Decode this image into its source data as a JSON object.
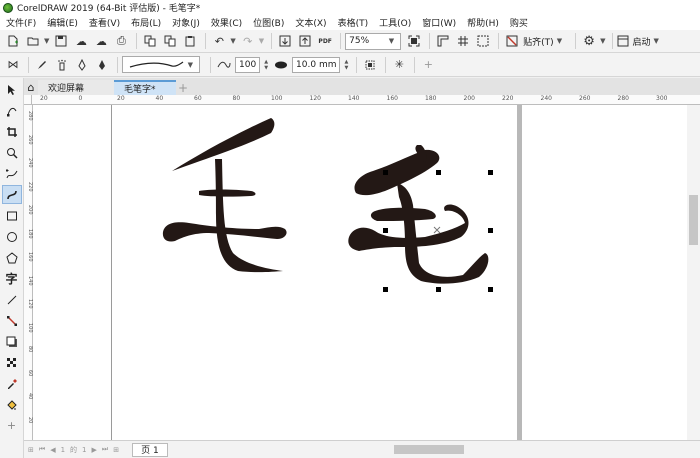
{
  "window": {
    "title": "CorelDRAW 2019 (64-Bit 评估版) - 毛笔字*"
  },
  "menu": {
    "items": [
      {
        "label": "文件(F)"
      },
      {
        "label": "编辑(E)"
      },
      {
        "label": "查看(V)"
      },
      {
        "label": "布局(L)"
      },
      {
        "label": "对象(J)"
      },
      {
        "label": "效果(C)"
      },
      {
        "label": "位图(B)"
      },
      {
        "label": "文本(X)"
      },
      {
        "label": "表格(T)"
      },
      {
        "label": "工具(O)"
      },
      {
        "label": "窗口(W)"
      },
      {
        "label": "帮助(H)"
      },
      {
        "label": "购买"
      }
    ]
  },
  "standard_toolbar": {
    "zoom_value": "75%",
    "snap_label": "贴齐(T)",
    "launch_label": "启动"
  },
  "property_bar": {
    "smoothing_value": "100",
    "outline_width": "10.0 mm"
  },
  "tabs": {
    "welcome_label": "欢迎屏幕",
    "document_label": "毛笔字*"
  },
  "ruler": {
    "h_ticks": [
      "20",
      "0",
      "20",
      "40",
      "60",
      "80",
      "100",
      "120",
      "140",
      "160",
      "180",
      "200",
      "220",
      "240",
      "260",
      "280",
      "300"
    ],
    "v_ticks": [
      "280",
      "260",
      "240",
      "220",
      "200",
      "180",
      "160",
      "140",
      "120",
      "100",
      "80",
      "60",
      "40",
      "20"
    ]
  },
  "status": {
    "page_label": "页 1",
    "page_count": "1",
    "of_label": "的",
    "page_total": "1"
  },
  "colors": {
    "brush_ink": "#231815",
    "active_tab": "#cfe3f6",
    "tab_accent": "#5b9bd5",
    "selection_handle": "#000000"
  }
}
